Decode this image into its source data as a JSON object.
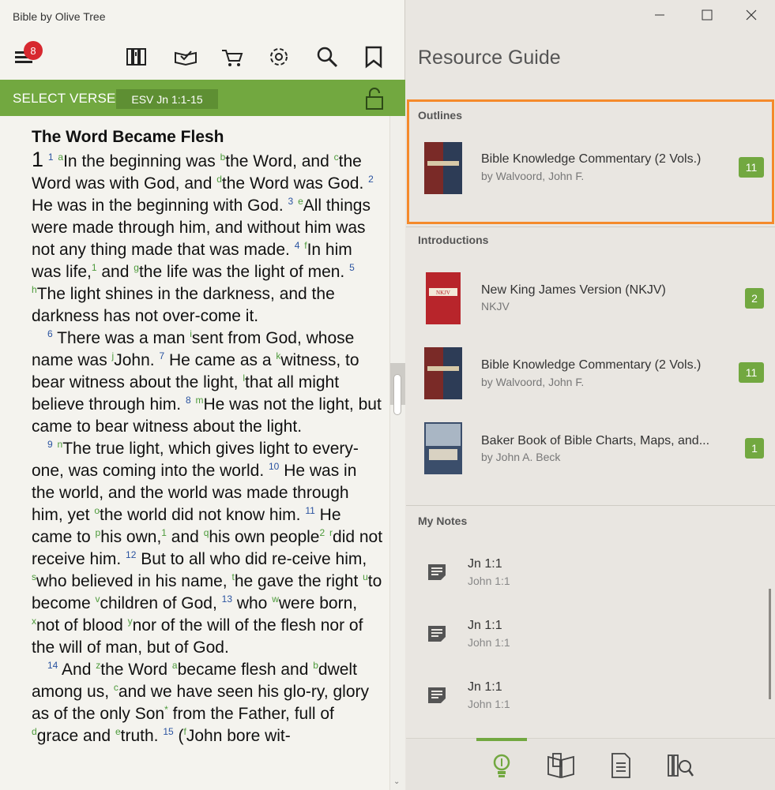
{
  "app": {
    "title": "Bible by Olive Tree"
  },
  "toolbar": {
    "menu_badge": "8"
  },
  "verse_bar": {
    "title": "SELECT VERSE",
    "reference": "ESV Jn 1:1-15"
  },
  "bible": {
    "heading": "The Word Became Flesh",
    "chapter": "1"
  },
  "resource_guide": {
    "title": "Resource Guide",
    "sections": {
      "outlines": "Outlines",
      "introductions": "Introductions",
      "my_notes": "My Notes"
    },
    "outlines": [
      {
        "title": "Bible Knowledge Commentary (2 Vols.)",
        "author": "by Walvoord, John F.",
        "count": "11"
      }
    ],
    "introductions": [
      {
        "title": "New King James Version (NKJV)",
        "author": "NKJV",
        "count": "2",
        "cover_label": "NKJV"
      },
      {
        "title": "Bible Knowledge Commentary (2 Vols.)",
        "author": "by Walvoord, John F.",
        "count": "11"
      },
      {
        "title": "Baker Book of Bible Charts, Maps, and...",
        "author": "by John A. Beck",
        "count": "1"
      }
    ],
    "notes": [
      {
        "title": "Jn 1:1",
        "ref": "John 1:1"
      },
      {
        "title": "Jn 1:1",
        "ref": "John 1:1"
      },
      {
        "title": "Jn 1:1",
        "ref": "John 1:1"
      }
    ]
  },
  "colors": {
    "accent_green": "#72a840",
    "badge_red": "#d7282f",
    "highlight_orange": "#f58a2b"
  },
  "icons": {
    "toolbar": [
      "menu-icon",
      "library-icon",
      "reading-plan-icon",
      "cart-icon",
      "gear-icon",
      "search-icon",
      "bookmark-icon"
    ],
    "bottom_tabs": [
      "lightbulb-icon",
      "open-book-icon",
      "document-icon",
      "library-search-icon"
    ]
  }
}
